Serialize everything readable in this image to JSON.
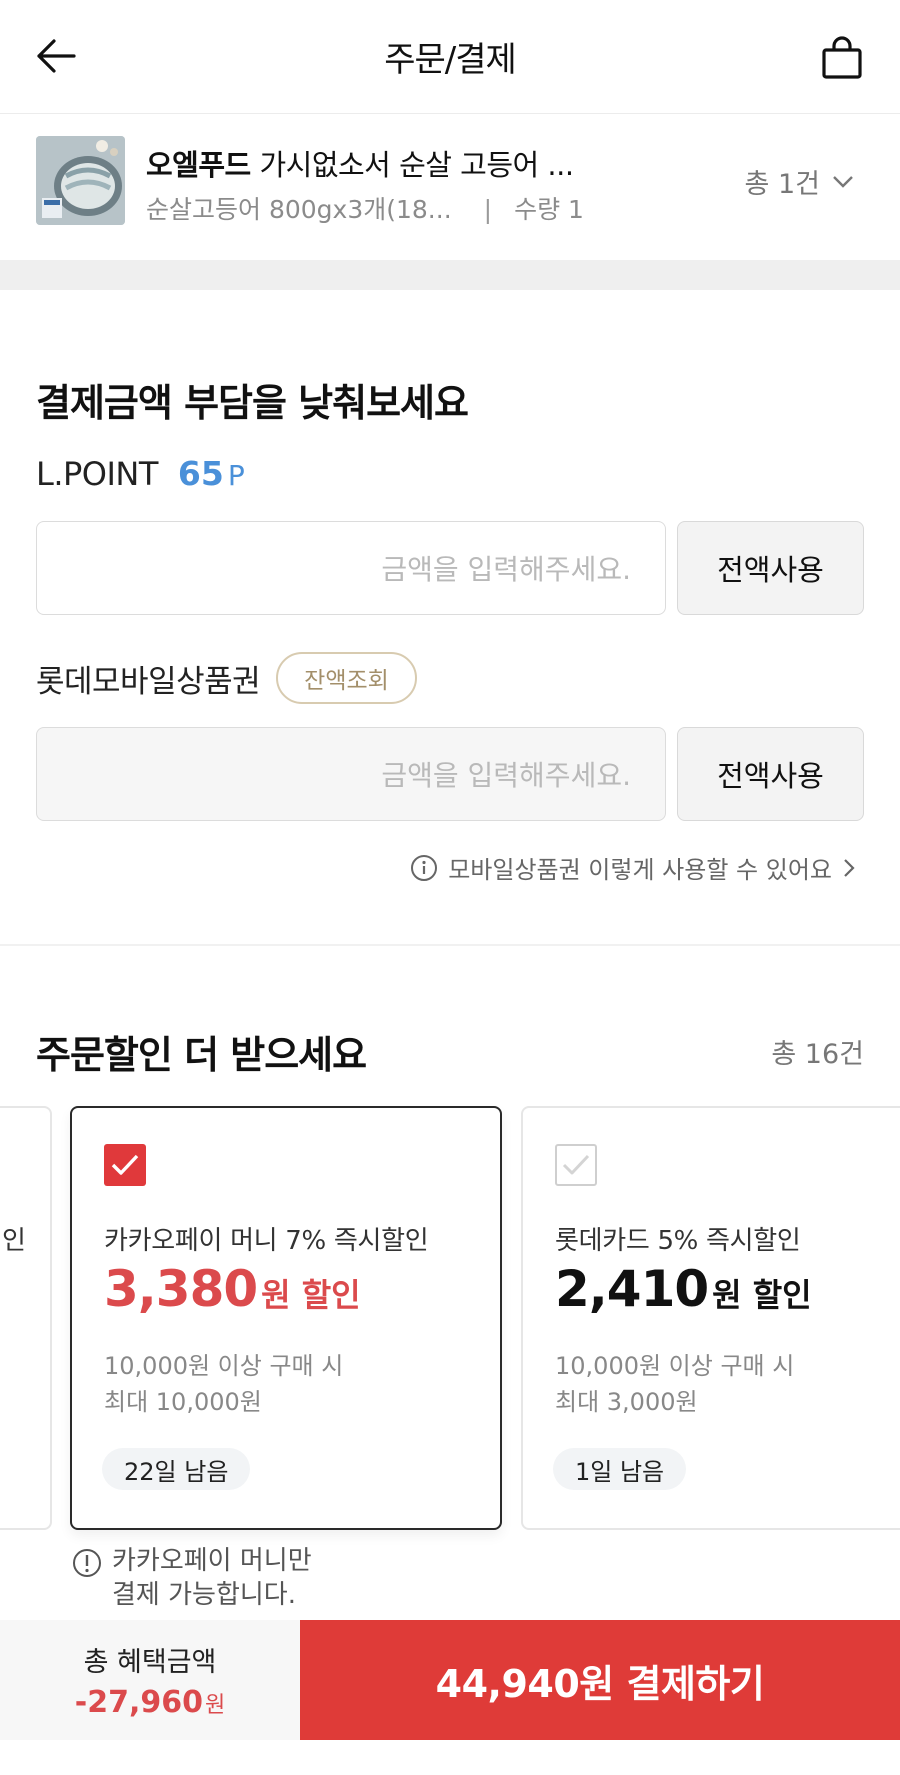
{
  "header": {
    "title": "주문/결제",
    "back_icon": "arrow-left-icon",
    "cart_icon": "shopping-bag-icon"
  },
  "product": {
    "brand": "오엘푸드",
    "name": "가시없소서 순살 고등어 ...",
    "option": "순살고등어 800gx3개(18...",
    "separator": "|",
    "quantity": "수량 1",
    "total_count": "총 1건"
  },
  "discount_section": {
    "title": "결제금액 부담을 낮춰보세요",
    "lpoint": {
      "label": "L.POINT",
      "value": "65",
      "unit": "P",
      "placeholder": "금액을 입력해주세요.",
      "button": "전액사용"
    },
    "mobile_voucher": {
      "label": "롯데모바일상품권",
      "balance_button": "잔액조회",
      "placeholder": "금액을 입력해주세요.",
      "button": "전액사용"
    },
    "help_link": "모바일상품권 이렇게 사용할 수 있어요"
  },
  "order_discount": {
    "title": "주문할인 더 받으세요",
    "total": "총 16건",
    "partial_card_text": "인",
    "cards": [
      {
        "name": "카카오페이 머니 7% 즉시할인",
        "amount": "3,380",
        "amount_unit": "원 할인",
        "condition_line1": "10,000원 이상 구매 시",
        "condition_line2": "최대 10,000원",
        "days_left": "22일 남음",
        "selected": true
      },
      {
        "name": "롯데카드 5% 즉시할인",
        "amount": "2,410",
        "amount_unit": "원 할인",
        "condition_line1": "10,000원 이상 구매 시",
        "condition_line2": "최대 3,000원",
        "days_left": "1일 남음",
        "selected": false
      }
    ],
    "note_line1": "카카오페이 머니만",
    "note_line2": "결제 가능합니다."
  },
  "bottom_bar": {
    "benefit_label": "총 혜택금액",
    "benefit_value": "-27,960",
    "benefit_unit": "원",
    "pay_button": "44,940원 결제하기"
  },
  "colors": {
    "accent_red": "#df3b38",
    "discount_red": "#db4a4c",
    "point_blue": "#4a90d9",
    "gold_border": "#d8cbb0"
  }
}
